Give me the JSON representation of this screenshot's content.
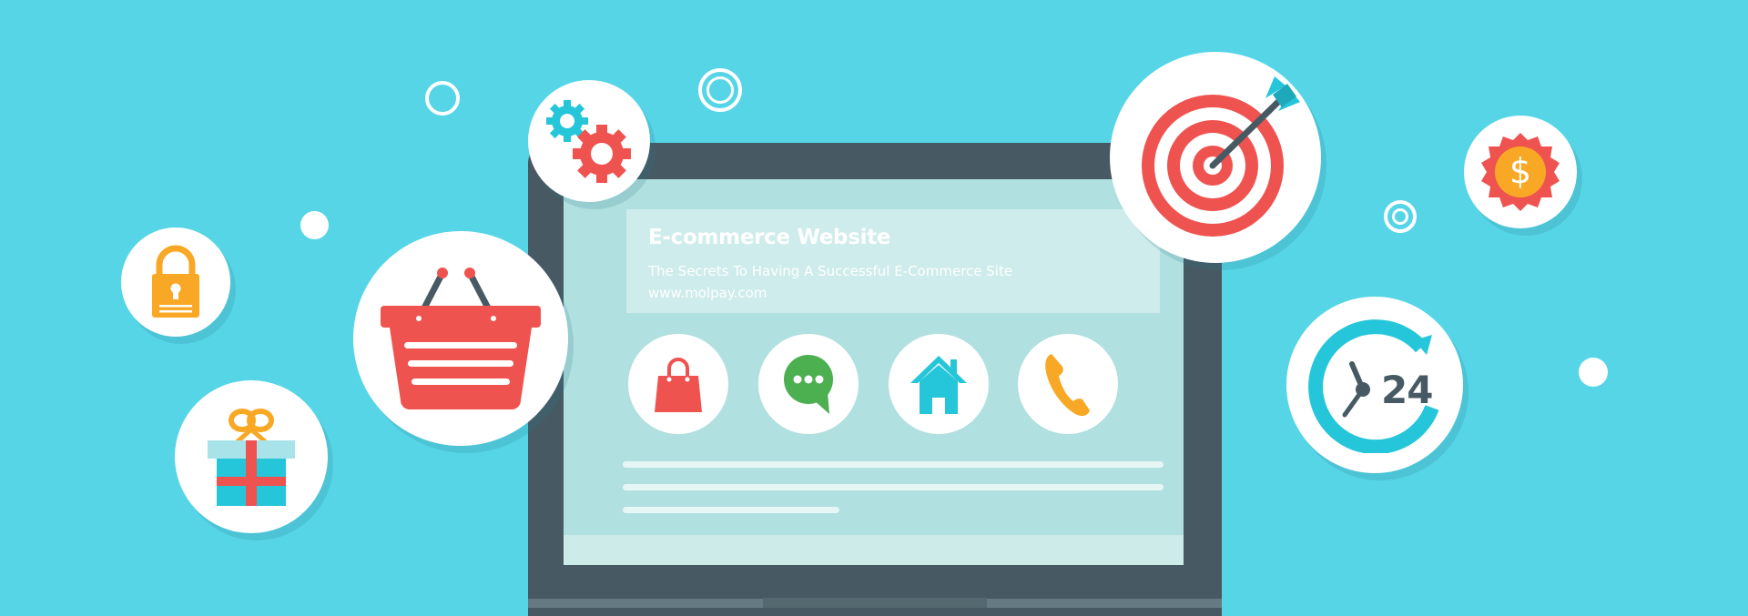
{
  "screen": {
    "title": "E-commerce Website",
    "subtitle": "The Secrets To Having A Successful E-Commerce Site",
    "url": "www.molpay.com",
    "icons": [
      "shopping-bag-icon",
      "chat-bubble-icon",
      "home-icon",
      "phone-icon"
    ]
  },
  "bubbles": {
    "clock_label": "24",
    "coin_symbol": "$",
    "items": [
      "lock-icon",
      "gift-icon",
      "basket-icon",
      "gears-icon",
      "target-icon",
      "coin-icon",
      "clock-24-icon"
    ]
  },
  "colors": {
    "background": "#56d5e7",
    "laptop_frame": "#475a63",
    "screen": "#b0e0df",
    "accent_red": "#ef5350",
    "accent_orange": "#f9a825",
    "accent_teal": "#26c6da",
    "accent_green": "#4caf50"
  }
}
